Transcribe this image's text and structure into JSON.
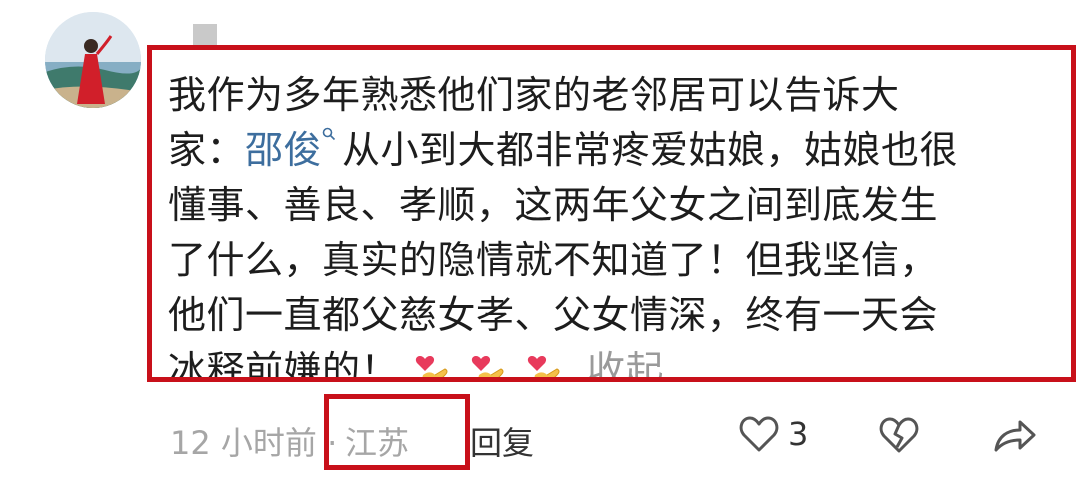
{
  "comment": {
    "lines": [
      "我作为多年熟悉他们家的老邻居可以告诉大",
      "从小到大都非常疼爱姑娘，姑娘也很",
      "懂事、善良、孝顺，这两年父女之间到底发生",
      "了什么，真实的隐情就不知道了！但我坚信，",
      "他们一直都父慈女孝、父女情深，终有一天会",
      "冰释前嫌的！"
    ],
    "line2_prefix": "家：",
    "mention": "邵俊",
    "collapse_label": "收起",
    "emojis": [
      "finger-heart-emoji",
      "finger-heart-emoji",
      "finger-heart-emoji"
    ]
  },
  "footer": {
    "time": "12 小时前 ·",
    "location": "江苏",
    "reply_label": "回复",
    "like_count": "3"
  },
  "colors": {
    "highlight": "#c8101a",
    "mention": "#3d6e9e",
    "muted": "#a6a6a6"
  }
}
